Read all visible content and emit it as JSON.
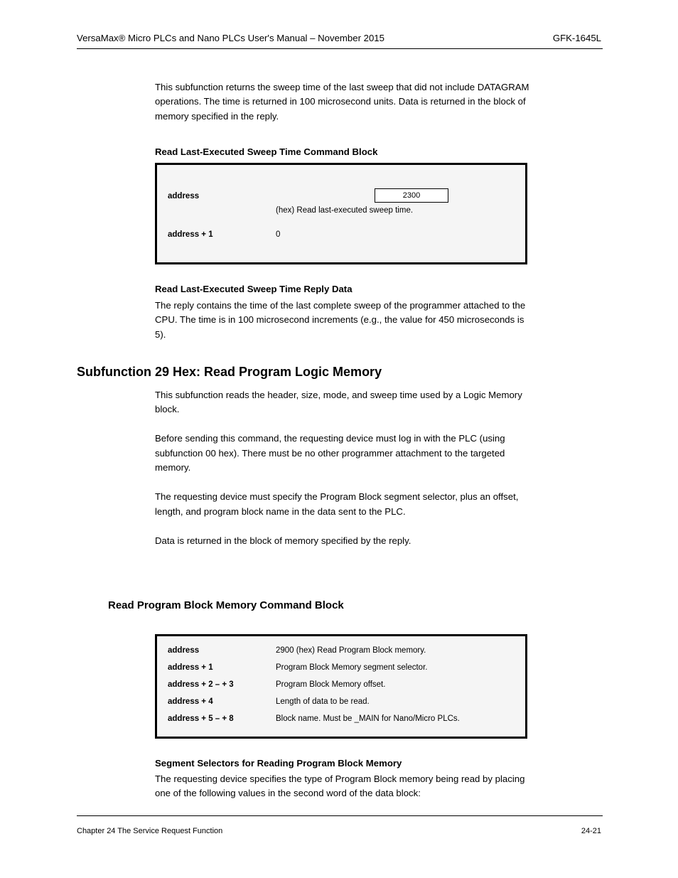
{
  "header": {
    "left": "VersaMax® Micro PLCs and Nano PLCs User's Manual – November 2015",
    "right": "GFK-1645L"
  },
  "intro": "This subfunction returns the sweep time of the last sweep that did not include DATAGRAM operations. The time is returned in 100 microsecond units. Data is returned in the block of memory specified in the reply.",
  "box1": {
    "title": "Read Last-Executed Sweep Time Command Block",
    "rows": [
      {
        "label": "address",
        "value": "2300",
        "after": "(hex) Read last-executed sweep time."
      },
      {
        "label": "address + 1",
        "value": "",
        "after": "0"
      }
    ]
  },
  "reply_heading": "Read Last-Executed Sweep Time Reply Data",
  "reply_body": "The reply contains the time of the last complete sweep of the programmer attached to the CPU. The time is in 100 microsecond increments (e.g., the value for 450 microseconds is 5).",
  "big_heading": "Subfunction 29 Hex: Read Program Logic Memory",
  "big_body": "This subfunction reads the header, size, mode, and sweep time used by a Logic Memory block.\n\nBefore sending this command, the requesting device must log in with the PLC (using subfunction 00 hex). There must be no other programmer attachment to the targeted memory.\n\nThe requesting device must specify the Program Block segment selector, plus an offset, length, and program block name in the data sent to the PLC.\n\nData is returned in the block of memory specified by the reply.",
  "box2": {
    "title": "Read Program Block Memory Command Block",
    "rows": [
      {
        "label": "address",
        "after": "2900 (hex) Read Program Block memory."
      },
      {
        "label": "address + 1",
        "after": "Program Block Memory segment selector."
      },
      {
        "label": "address + 2 – + 3",
        "after": "Program Block Memory offset."
      },
      {
        "label": "address + 4",
        "after": "Length of data to be read."
      },
      {
        "label": "address + 5 – + 8",
        "after": "Block name. Must be _MAIN for Nano/Micro PLCs."
      }
    ]
  },
  "segment_heading": "Segment Selectors for Reading Program Block Memory",
  "segment_body": "The requesting device specifies the type of Program Block memory being read by placing one of the following values in the second word of the data block:",
  "footer": {
    "left": "Chapter 24 The Service Request Function",
    "right": "24-21"
  }
}
